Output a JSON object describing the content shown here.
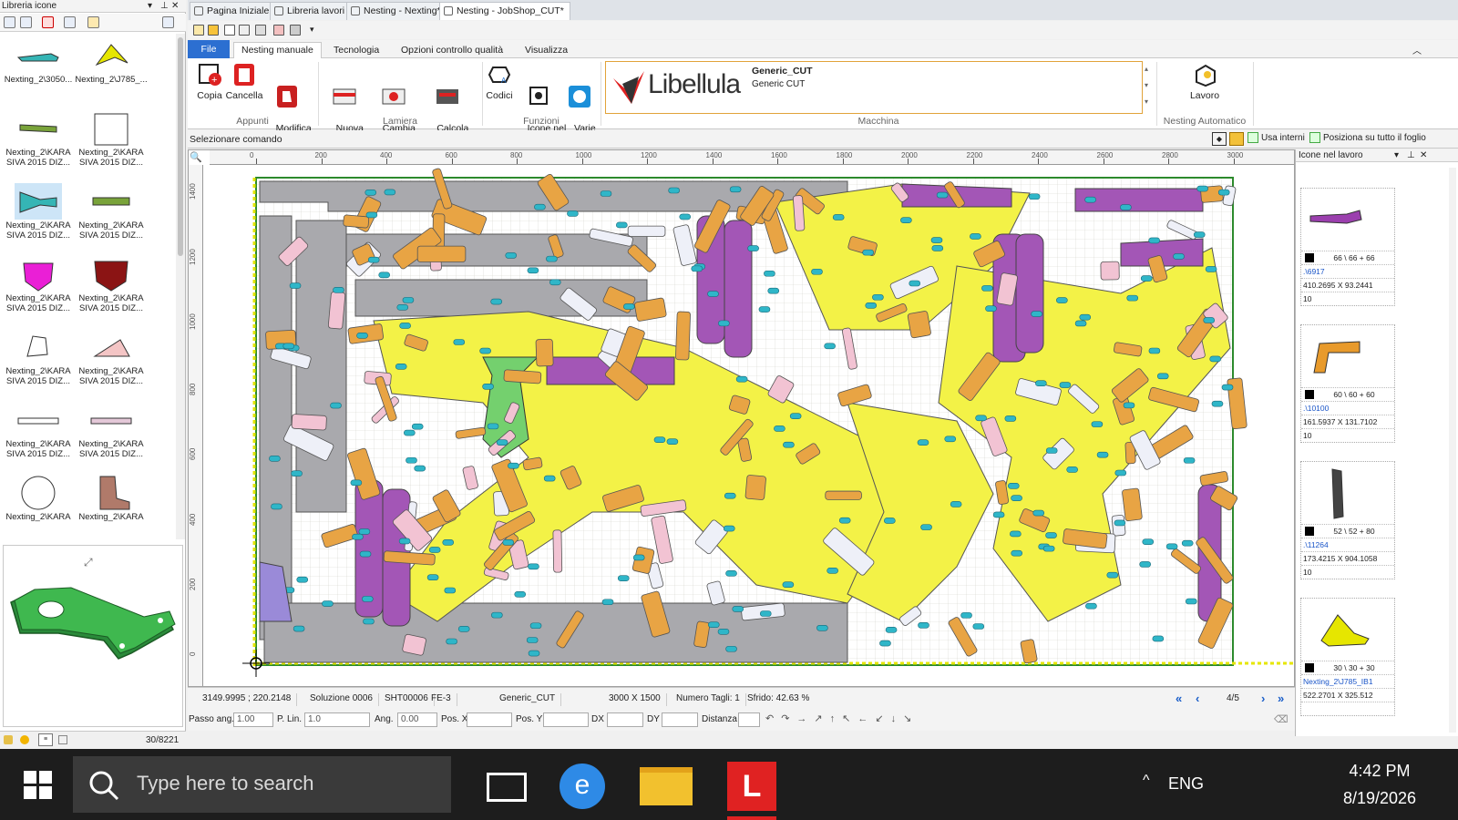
{
  "left_panel": {
    "title": "Libreria icone",
    "items": [
      {
        "label": "Nexting_2\\3050...",
        "color": "#35b5b5"
      },
      {
        "label": "Nexting_2\\J785_...",
        "color": "#e6e600"
      },
      {
        "label": "Nexting_2\\KARA\nSIVA 2015 DIZ...",
        "color": "#79a33a"
      },
      {
        "label": "Nexting_2\\KARA\nSIVA 2015 DIZ...",
        "color": "#ffffff"
      },
      {
        "label": "Nexting_2\\KARA\nSIVA 2015 DIZ...",
        "color": "#35b5b5"
      },
      {
        "label": "Nexting_2\\KARA\nSIVA 2015 DIZ...",
        "color": "#79a33a"
      },
      {
        "label": "Nexting_2\\KARA\nSIVA 2015 DIZ...",
        "color": "#ea1fd6"
      },
      {
        "label": "Nexting_2\\KARA\nSIVA 2015 DIZ...",
        "color": "#8b1414"
      },
      {
        "label": "Nexting_2\\KARA\nSIVA 2015 DIZ...",
        "color": "#ffffff"
      },
      {
        "label": "Nexting_2\\KARA\nSIVA 2015 DIZ...",
        "color": "#f4c5c5"
      },
      {
        "label": "Nexting_2\\KARA\nSIVA 2015 DIZ...",
        "color": "#ffffff"
      },
      {
        "label": "Nexting_2\\KARA\nSIVA 2015 DIZ...",
        "color": "#e4c8d8"
      },
      {
        "label": "Nexting_2\\KARA",
        "color": "#ffffff"
      },
      {
        "label": "Nexting_2\\KARA",
        "color": "#b07a6a"
      }
    ],
    "counter": "30/8221"
  },
  "doc_tabs": [
    {
      "label": "Pagina Iniziale",
      "active": false
    },
    {
      "label": "Libreria lavori",
      "active": false
    },
    {
      "label": "Nesting - Nexting*",
      "active": false
    },
    {
      "label": "Nesting - JobShop_CUT*",
      "active": true
    }
  ],
  "ribbon_tabs": [
    "File",
    "Nesting manuale",
    "Tecnologia",
    "Opzioni controllo qualità",
    "Visualizza"
  ],
  "ribbon": {
    "groups": [
      {
        "label": "Appunti",
        "buttons": [
          "Copia",
          "Cancella",
          "Modifica\nGeometria"
        ]
      },
      {
        "label": "Lamiera",
        "buttons": [
          "Nuova\nlamiera ▾",
          "Cambia\nlamiera ▾",
          "Calcola\nmultilamiera"
        ]
      },
      {
        "label": "Funzioni",
        "buttons": [
          "Codici",
          "Icone nel\nlavoro",
          "Varie\n▾"
        ]
      },
      {
        "label": "Macchina"
      },
      {
        "label": "Nesting Automatico",
        "buttons": [
          "Lavoro"
        ]
      }
    ],
    "machine": {
      "brand": "Libellula",
      "name": "Generic_CUT",
      "desc": "Generic CUT"
    }
  },
  "command_bar": {
    "prompt": "Selezionare comando",
    "usa_interni": "Usa interni",
    "posiziona": "Posiziona su tutto il foglio"
  },
  "rulers": {
    "h": [
      "0",
      "200",
      "400",
      "600",
      "800",
      "1000",
      "1200",
      "1400",
      "1600",
      "1800",
      "2000",
      "2200",
      "2400",
      "2600",
      "2800",
      "3000"
    ],
    "v": [
      "1400",
      "1200",
      "1000",
      "800",
      "600",
      "400",
      "200",
      "0"
    ]
  },
  "right_panel": {
    "title": "Icone nel lavoro",
    "cards": [
      {
        "qty": "66 \\ 66 + 66",
        "code": ".\\6917",
        "size": "410.2695 X 93.2441",
        "n": "10",
        "color": "#9b3fae"
      },
      {
        "qty": "60 \\ 60 + 60",
        "code": ".\\10100",
        "size": "161.5937 X 131.7102",
        "n": "10",
        "color": "#e89a2b"
      },
      {
        "qty": "52 \\ 52 + 80",
        "code": ".\\11264",
        "size": "173.4215 X 904.1058",
        "n": "10",
        "color": "#444444"
      },
      {
        "qty": "30 \\ 30 + 30",
        "code": "Nexting_2\\J785_IB1",
        "size": "522.2701 X 325.512",
        "n": "",
        "color": "#e6e600"
      }
    ]
  },
  "status": {
    "coords": "3149.9995 ; 220.2148",
    "solution": "Soluzione 0006",
    "sheet": "SHT00006",
    "material": "FE-3",
    "machine": "Generic_CUT",
    "size": "3000 X 1500",
    "cuts": "Numero Tagli: 1",
    "waste": "Sfrido: 42.63 %",
    "page": "4/5"
  },
  "inputs": {
    "passo_label": "Passo ang.",
    "passo": "1.00",
    "plin_label": "P. Lin.",
    "plin": "1.0",
    "ang_label": "Ang.",
    "ang": "0.00",
    "posx_label": "Pos. X",
    "posy_label": "Pos. Y",
    "dx_label": "DX",
    "dy_label": "DY",
    "dist_label": "Distanza"
  },
  "taskbar": {
    "search_placeholder": "Type here to search",
    "lang": "ENG",
    "time": "4:42 PM",
    "date": "8/19/2026"
  },
  "colors": {
    "accent": "#2c6fd1",
    "sheet_bg": "#f7f7f2",
    "part_yellow": "#f3f247",
    "part_gray": "#a9a9ad",
    "part_purple": "#a356b6",
    "part_orange": "#e8a444",
    "part_pink": "#f2c3d3",
    "part_green": "#74d06e",
    "hole_cyan": "#2fb6c8"
  }
}
